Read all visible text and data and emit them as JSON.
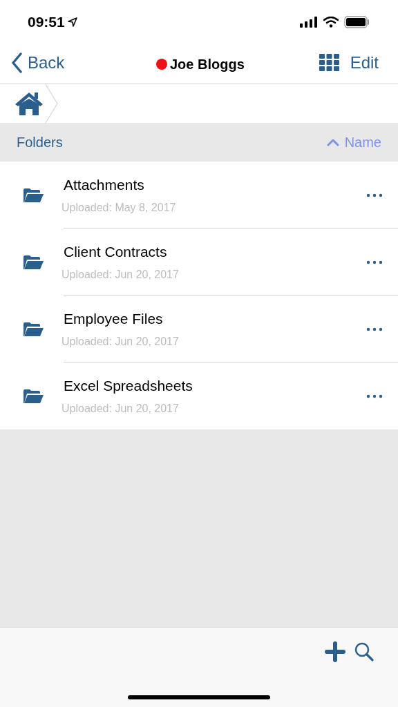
{
  "status_bar": {
    "time": "09:51"
  },
  "nav": {
    "back": "Back",
    "title": "Joe Bloggs",
    "status": {
      "color": "#f20f16"
    },
    "edit": "Edit"
  },
  "section": {
    "title": "Folders",
    "sort": {
      "label": "Name",
      "ascending": true
    }
  },
  "folders": [
    {
      "name": "Attachments",
      "uploaded": "Uploaded: May 8, 2017"
    },
    {
      "name": "Client Contracts",
      "uploaded": "Uploaded: Jun 20, 2017"
    },
    {
      "name": "Employee Files",
      "uploaded": "Uploaded: Jun 20, 2017"
    },
    {
      "name": "Excel Spreadsheets",
      "uploaded": "Uploaded: Jun 20, 2017"
    }
  ]
}
